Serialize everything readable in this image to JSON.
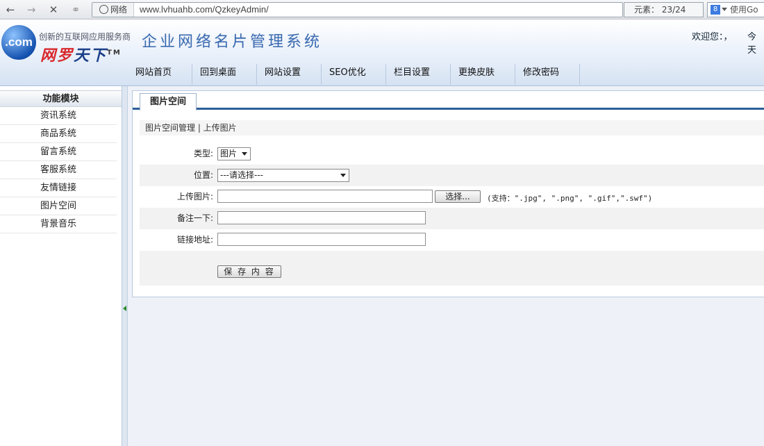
{
  "browser": {
    "network_label": "网络",
    "url": "www.lvhuahb.com/QzkeyAdmin/",
    "elements_label": "元素：  23/24",
    "search_label": "使用Go",
    "search_badge": "8"
  },
  "header": {
    "logo_text": ".com",
    "slogan": "创新的互联网应用服务商",
    "brand_red": "网罗",
    "brand_blue": "天下",
    "brand_tm": "TM",
    "system_title": "企业网络名片管理系统",
    "welcome": "欢迎您：，",
    "today": "今天"
  },
  "topnav": [
    {
      "label": "网站首页"
    },
    {
      "label": "回到桌面"
    },
    {
      "label": "网站设置"
    },
    {
      "label": "SEO优化"
    },
    {
      "label": "栏目设置"
    },
    {
      "label": "更换皮肤"
    },
    {
      "label": "修改密码"
    }
  ],
  "sidebar": {
    "title": "功能模块",
    "items": [
      {
        "label": "资讯系统"
      },
      {
        "label": "商品系统"
      },
      {
        "label": "留言系统"
      },
      {
        "label": "客服系统"
      },
      {
        "label": "友情链接"
      },
      {
        "label": "图片空间"
      },
      {
        "label": "背景音乐"
      }
    ]
  },
  "main": {
    "tab_label": "图片空间",
    "breadcrumb": "图片空间管理 | 上传图片",
    "form": {
      "type_label": "类型:",
      "type_value": "图片",
      "position_label": "位置:",
      "position_value": "---请选择---",
      "upload_label": "上传图片:",
      "upload_button": "选择...",
      "upload_hint": "(支持：\".jpg\", \".png\", \".gif\",\".swf\")",
      "note_label": "备注一下:",
      "link_label": "链接地址:",
      "save_button": "保 存 内 容"
    }
  }
}
